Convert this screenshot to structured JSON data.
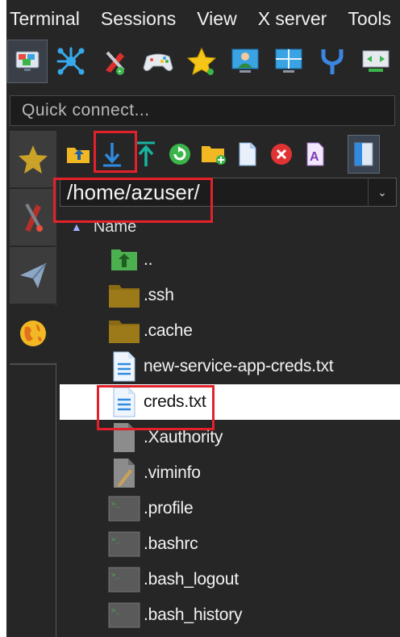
{
  "menu": {
    "items": [
      "Terminal",
      "Sessions",
      "View",
      "X server",
      "Tools"
    ]
  },
  "toolbar": {
    "icons": [
      "session-icon",
      "servers-icon",
      "tools-icon",
      "games-icon",
      "favorites-icon",
      "user-session-icon",
      "multi-exec-icon",
      "split-icon",
      "tunneling-icon"
    ]
  },
  "quick_connect": {
    "placeholder": "Quick connect..."
  },
  "sidebar_tabs": [
    "favorites-star-icon",
    "tools-knife-icon",
    "send-paper-plane-icon",
    "sftp-globe-icon"
  ],
  "sftp": {
    "toolbar_icons": [
      "parent-folder-icon",
      "download-icon",
      "upload-icon",
      "refresh-icon",
      "new-folder-icon",
      "new-file-icon",
      "delete-icon",
      "rename-icon",
      "toggle-panel-icon"
    ],
    "path": "/home/azuser/",
    "column_name": "Name",
    "files": [
      {
        "name": "..",
        "type": "parent"
      },
      {
        "name": ".ssh",
        "type": "folder"
      },
      {
        "name": ".cache",
        "type": "folder"
      },
      {
        "name": "new-service-app-creds.txt",
        "type": "text"
      },
      {
        "name": "creds.txt",
        "type": "text",
        "selected": true
      },
      {
        "name": ".Xauthority",
        "type": "blank"
      },
      {
        "name": ".viminfo",
        "type": "edit"
      },
      {
        "name": ".profile",
        "type": "shell"
      },
      {
        "name": ".bashrc",
        "type": "shell"
      },
      {
        "name": ".bash_logout",
        "type": "shell"
      },
      {
        "name": ".bash_history",
        "type": "shell"
      }
    ]
  },
  "colors": {
    "background": "#262626",
    "highlight": "#e3212b",
    "accent": "#2f8ae0"
  }
}
